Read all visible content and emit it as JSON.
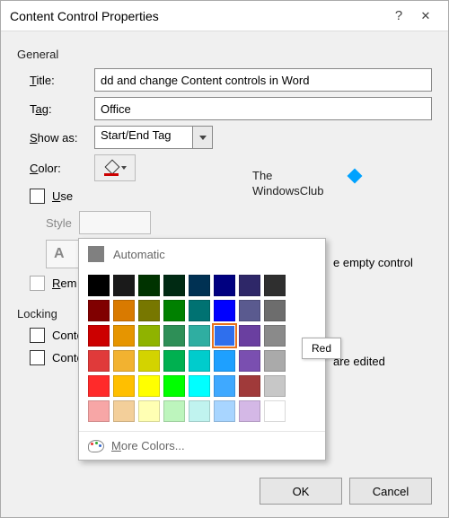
{
  "titlebar": {
    "title": "Content Control Properties"
  },
  "general": {
    "label": "General",
    "title_label": "Title:",
    "title_value": "dd and change Content controls in Word",
    "tag_label": "Tag:",
    "tag_value": "Office",
    "showas_label": "Show as:",
    "showas_value": "Start/End Tag",
    "color_label": "Color:",
    "use_style_label": "Use",
    "use_style_trailing": "e empty control",
    "style_label": "Style",
    "newstyle_label": "A",
    "remove_label": "Rem",
    "remove_trailing": "are edited"
  },
  "locking": {
    "label": "Locking",
    "cannot_delete": "Content control cannot be deleted",
    "cannot_edit": "Contents cannot be edited"
  },
  "buttons": {
    "ok": "OK",
    "cancel": "Cancel"
  },
  "watermark": {
    "line1": "The",
    "line2": "WindowsClub"
  },
  "color_popup": {
    "automatic": "Automatic",
    "more": "More Colors...",
    "tooltip": "Red",
    "selected_index": 21,
    "swatches": [
      "#000000",
      "#1a1a1a",
      "#003300",
      "#002a13",
      "#003153",
      "#000080",
      "#2e2768",
      "#2f2f2f",
      "#800000",
      "#d97a00",
      "#777700",
      "#008000",
      "#007272",
      "#0000ff",
      "#5a5a8f",
      "#6d6d6d",
      "#cc0000",
      "#e69500",
      "#8fb300",
      "#2e8f57",
      "#2faea1",
      "#2f6fed",
      "#6a3fa0",
      "#8a8a8a",
      "#e03a3a",
      "#f2b230",
      "#d3d300",
      "#00b050",
      "#00cccc",
      "#1ea0ff",
      "#7a4fb0",
      "#aaaaaa",
      "#ff2a2a",
      "#ffbf00",
      "#ffff00",
      "#00ff00",
      "#00ffff",
      "#3fa9ff",
      "#a03a3a",
      "#c7c7c7",
      "#f7a6a6",
      "#f3cf9a",
      "#ffffb3",
      "#bdf5bd",
      "#c0f3ef",
      "#a8d5ff",
      "#d4b8e6",
      "#ffffff"
    ]
  }
}
